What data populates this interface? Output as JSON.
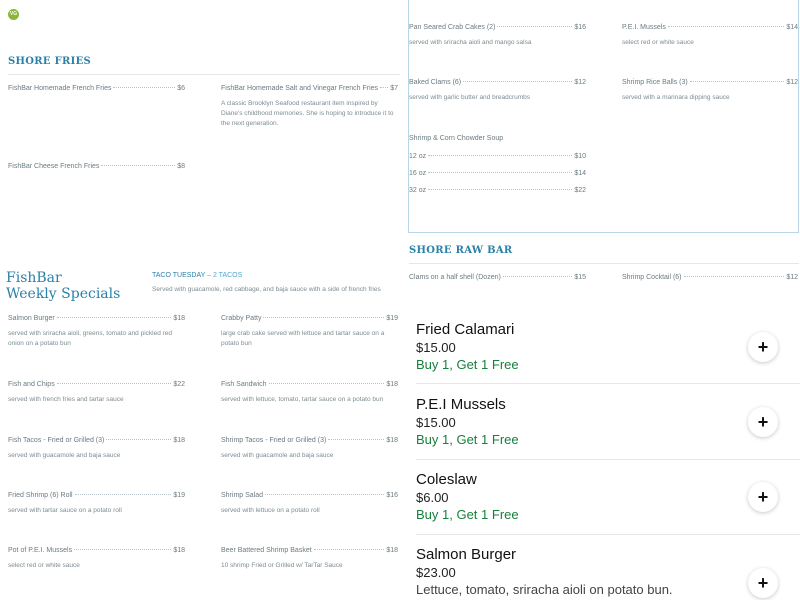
{
  "badge": "VG",
  "shore_fries": {
    "title": "SHORE FRIES",
    "items": [
      {
        "name": "FishBar Homemade French Fries",
        "price": "$6"
      },
      {
        "name": "FishBar Homemade Salt and Vinegar French Fries",
        "price": "$7",
        "desc": "A classic Brooklyn Seafood restaurant item inspired by Diane's childhood memories. She is hoping to introduce it to the next generation."
      },
      {
        "name": "FishBar Cheese French Fries",
        "price": "$8"
      }
    ]
  },
  "apps": {
    "items": [
      {
        "name": "Pan Seared Crab Cakes (2)",
        "price": "$16",
        "desc": "served with sriracha aioli and mango salsa"
      },
      {
        "name": "P.E.I. Mussels",
        "price": "$14",
        "desc": "select red or white sauce"
      },
      {
        "name": "Baked Clams (6)",
        "price": "$12",
        "desc": "served with garlic butter and breadcrumbs"
      },
      {
        "name": "Shrimp Rice Balls (3)",
        "price": "$12",
        "desc": "served with a marinara dipping sauce"
      }
    ],
    "soup": {
      "name": "Shrimp & Corn Chowder Soup",
      "sizes": [
        {
          "name": "12 oz",
          "price": "$10"
        },
        {
          "name": "16 oz",
          "price": "$14"
        },
        {
          "name": "32 oz",
          "price": "$22"
        }
      ]
    }
  },
  "raw_bar": {
    "title": "SHORE RAW BAR",
    "items": [
      {
        "name": "Clams on a half shell (Dozen)",
        "price": "$15"
      },
      {
        "name": "Shrimp Cocktail (6)",
        "price": "$12"
      }
    ]
  },
  "weekly": {
    "title_line1": "FishBar",
    "title_line2": "Weekly Specials",
    "taco_label": "TACO TUESDAY",
    "taco_highlight": "– 2 TACOS",
    "taco_desc": "Served with guacamole, red cabbage, and baja sauce with a side of french fries",
    "items": [
      {
        "name": "Salmon Burger",
        "price": "$18",
        "desc": "served with sriracha aioli, greens, tomato and pickled red onion on a potato bun"
      },
      {
        "name": "Crabby Patty",
        "price": "$19",
        "desc": "large crab cake served with lettuce and tartar sauce on a potato bun"
      },
      {
        "name": "Fish and Chips",
        "price": "$22",
        "desc": "served with french fries and tartar sauce"
      },
      {
        "name": "Fish Sandwich",
        "price": "$18",
        "desc": "served with lettuce, tomato, tartar sauce on a potato bun"
      },
      {
        "name": "Fish Tacos - Fried or Grilled (3)",
        "price": "$18",
        "desc": "served with guacamole and baja sauce"
      },
      {
        "name": "Shrimp Tacos - Fried or Grilled (3)",
        "price": "$18",
        "desc": "served with guacamole and baja sauce"
      },
      {
        "name": "Fried Shrimp (6) Roll",
        "price": "$19",
        "desc": "served with tartar sauce on a potato roll"
      },
      {
        "name": "Shrimp Salad",
        "price": "$16",
        "desc": "served with lettuce on a potato roll"
      },
      {
        "name": "Pot of P.E.I. Mussels",
        "price": "$18",
        "desc": "select red or white sauce"
      },
      {
        "name": "Beer Battered Shrimp Basket",
        "price": "$18",
        "desc": "10 shrimp Fried or Grilled w/ TarTar Sauce"
      }
    ]
  },
  "cart": {
    "add_symbol": "+",
    "items": [
      {
        "name": "Fried Calamari",
        "price": "$15.00",
        "promo": "Buy 1, Get 1 Free"
      },
      {
        "name": "P.E.I Mussels",
        "price": "$15.00",
        "promo": "Buy 1, Get 1 Free"
      },
      {
        "name": "Coleslaw",
        "price": "$6.00",
        "promo": "Buy 1, Get 1 Free"
      },
      {
        "name": "Salmon Burger",
        "price": "$23.00",
        "desc": "Lettuce, tomato, sriracha aioli on potato bun."
      }
    ]
  },
  "colors": {
    "heading_blue": "#2b80a8",
    "promo_green": "#17803d",
    "badge_green": "#8cb53c"
  }
}
